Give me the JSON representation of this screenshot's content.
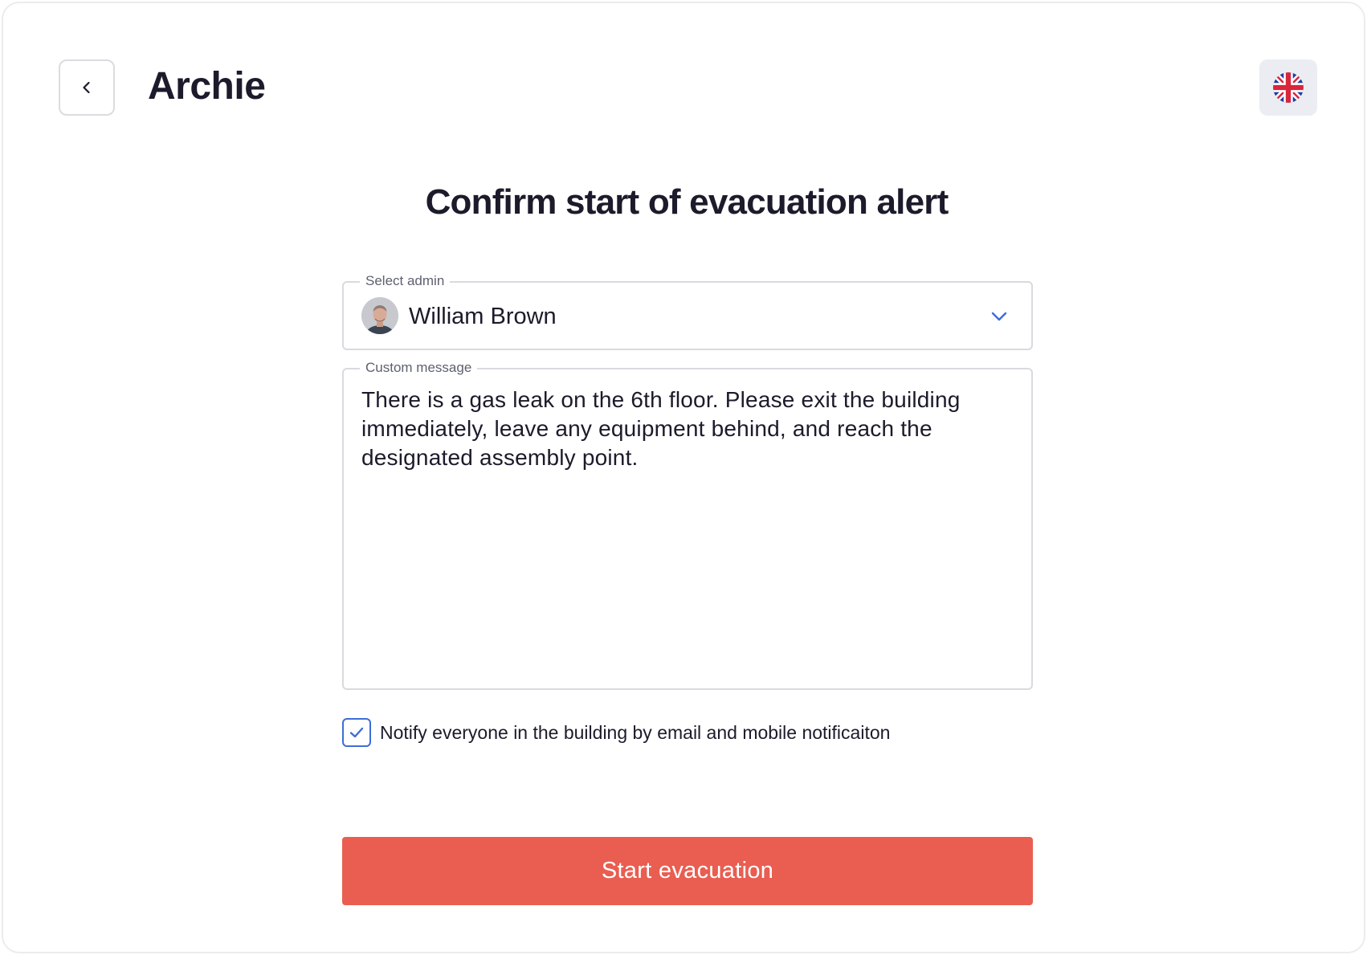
{
  "app": {
    "title": "Archie",
    "back_icon": "chevron-left-icon",
    "language_icon": "uk-flag-icon"
  },
  "page": {
    "heading": "Confirm start of evacuation alert"
  },
  "form": {
    "admin_select": {
      "legend": "Select admin",
      "value": "William Brown",
      "icon": "chevron-down-icon"
    },
    "custom_message": {
      "legend": "Custom message",
      "value": "There is a gas leak on the 6th floor. Please exit the building immediately, leave any equipment behind, and reach the designated assembly point."
    },
    "notify": {
      "checked": true,
      "label": "Notify everyone in the building by email and mobile notificaiton"
    },
    "submit_label": "Start evacuation"
  },
  "colors": {
    "primary_action": "#e95e51",
    "accent": "#3e6cd9",
    "text": "#1b1b2b",
    "muted_text": "#5d6170",
    "border": "#d9dadf"
  }
}
